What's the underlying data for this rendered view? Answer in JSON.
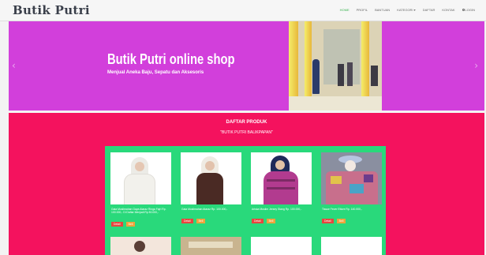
{
  "brand": "Butik Putri",
  "nav": {
    "items": [
      "HOME",
      "PROFIL",
      "BANTUAN",
      "KATEGORI",
      "DAFTAR",
      "KONTAK",
      "LOGIN"
    ],
    "active_index": 0
  },
  "hero": {
    "title": "Butik Putri online shop",
    "subtitle": "Menjual Aneka Baju, Sepatu dan Aksesoris",
    "prev_arrow": "‹",
    "next_arrow": "›"
  },
  "products_section": {
    "title": "DAFTAR PRODUK",
    "subtitle": "\"BUTIK PUTRI BALIKPAPAN\"",
    "products": [
      {
        "name": "Gaia Muslimahan Gaya Ataraz Ringa Fajri Rp. 100.000,- Di Daftar Menjadi Rp 80.000,-",
        "detail_label": "Detail",
        "buy_label": "Beli"
      },
      {
        "name": "Gaia Muslimahan Ataraz Rp. 100.000,-",
        "detail_label": "Detail",
        "buy_label": "Beli"
      },
      {
        "name": "Ariska Muslim Jersey Stang Rp. 100.000,-",
        "detail_label": "Detail",
        "buy_label": "Beli"
      },
      {
        "name": "Tissue Fever Ettore Rp. 140.000,-",
        "detail_label": "Detail",
        "buy_label": "Beli"
      }
    ]
  },
  "colors": {
    "hero_bg": "#d23fdb",
    "section_bg": "#f4125e",
    "panel_bg": "#29d97b",
    "detail_button": "#e8463e",
    "buy_button": "#f0a33b",
    "nav_active": "#37b24d"
  }
}
